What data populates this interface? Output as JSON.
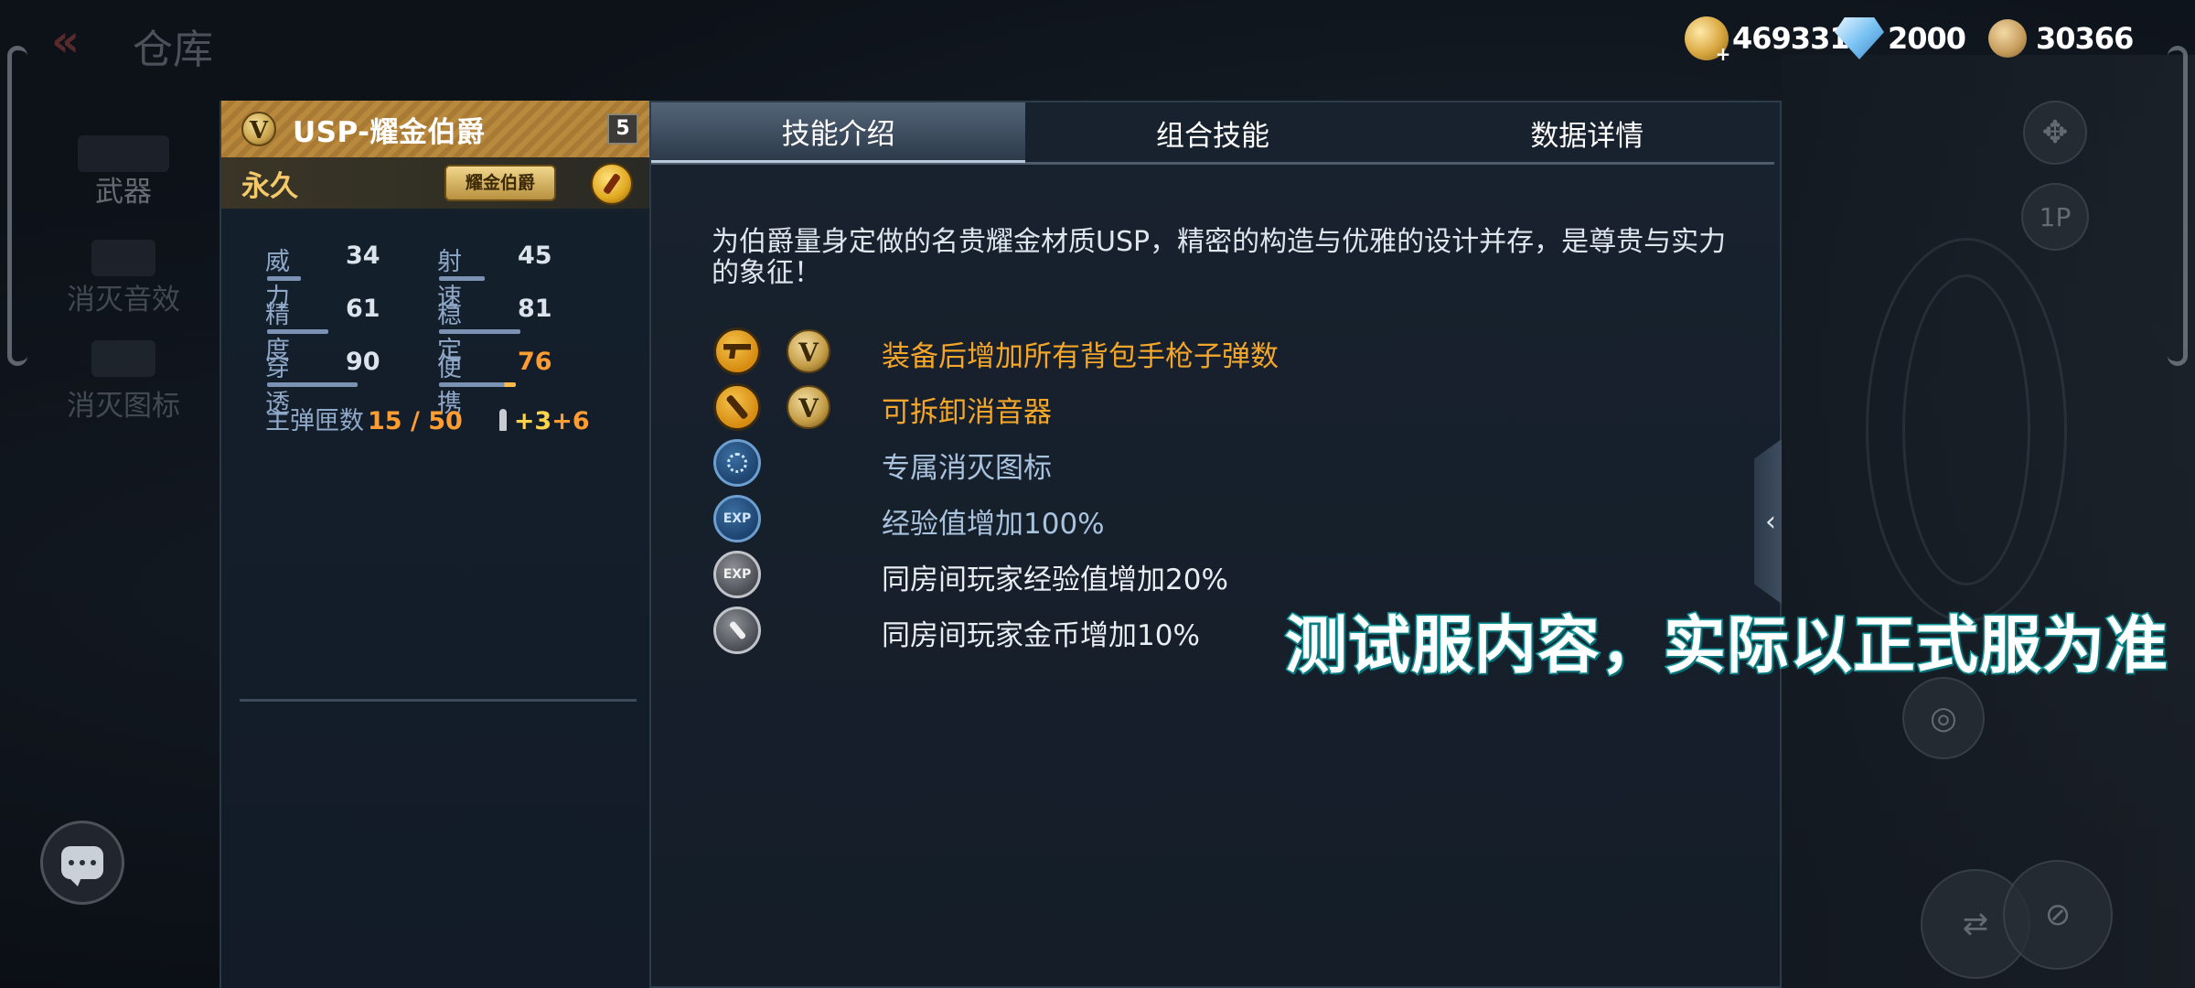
{
  "header": {
    "title": "仓库",
    "currencies": [
      {
        "type": "gold",
        "value": "469331"
      },
      {
        "type": "diamond",
        "value": "2000"
      },
      {
        "type": "medal",
        "value": "30366"
      }
    ]
  },
  "nav": {
    "items": [
      "武器",
      "消灭音效",
      "消灭图标"
    ]
  },
  "weapon": {
    "name": "USP-耀金伯爵",
    "level": "5",
    "duration": "永久",
    "rank_badge": "耀金伯爵",
    "emblem": "V",
    "stats": [
      {
        "label": "威力",
        "value": "34",
        "fill": 0.34
      },
      {
        "label": "射速",
        "value": "45",
        "fill": 0.45
      },
      {
        "label": "精度",
        "value": "61",
        "fill": 0.61
      },
      {
        "label": "稳定",
        "value": "81",
        "fill": 0.81
      },
      {
        "label": "穿透",
        "value": "90",
        "fill": 0.9
      },
      {
        "label": "便携",
        "value": "76",
        "fill": 0.76
      }
    ],
    "magazine": {
      "label": "主弹匣数",
      "value": "15 / 50",
      "bonus_a": "+3",
      "bonus_b": "+6"
    }
  },
  "panel": {
    "tabs": [
      "技能介绍",
      "组合技能",
      "数据详情"
    ],
    "active_tab": 0,
    "description": "为伯爵量身定做的名贵耀金材质USP，精密的构造与优雅的设计并存，是尊贵与实力的象征！",
    "skills": [
      {
        "icon": "pistol-ammo-icon",
        "text": "装备后增加所有背包手枪子弹数",
        "color": "gold",
        "vip": true
      },
      {
        "icon": "silencer-icon",
        "text": "可拆卸消音器",
        "color": "gold",
        "vip": true
      },
      {
        "icon": "kill-icon-badge",
        "text": "专属消灭图标",
        "color": "blue",
        "vip": false
      },
      {
        "icon": "exp-boost-icon",
        "text": "经验值增加100%",
        "color": "blue",
        "vip": false
      },
      {
        "icon": "room-exp-icon",
        "text": "同房间玩家经验值增加20%",
        "color": "white",
        "vip": false
      },
      {
        "icon": "room-coin-icon",
        "text": "同房间玩家金币增加10%",
        "color": "white",
        "vip": false
      }
    ]
  },
  "watermark": "测试服内容，实际以正式服为准",
  "colors": {
    "accent_gold": "#f3a62a",
    "stat_orange": "#ff9c32",
    "watermark_stroke": "#1aa5a8"
  }
}
